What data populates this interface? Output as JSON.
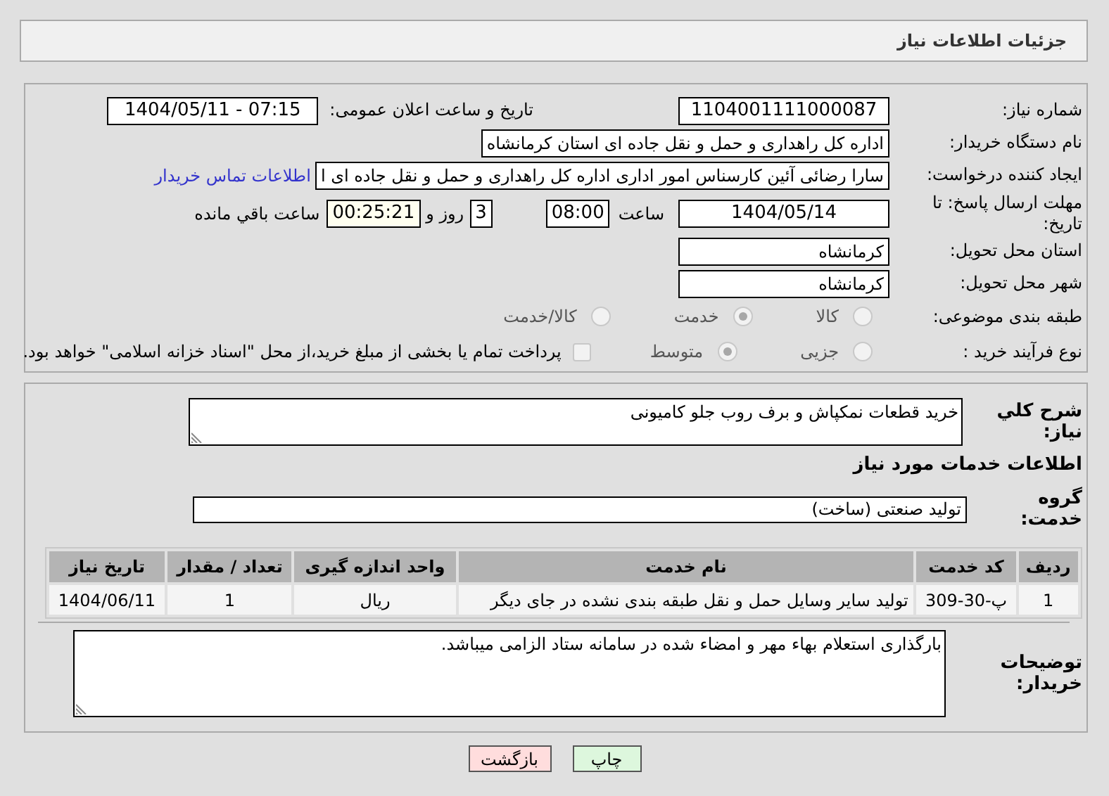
{
  "header": {
    "title": "جزئیات اطلاعات نیاز"
  },
  "details": {
    "need_number": {
      "label": "شماره نیاز:",
      "value": "1104001111000087"
    },
    "announce": {
      "label": "تاریخ و ساعت اعلان عمومی:",
      "value": "1404/05/11 - 07:15"
    },
    "buyer": {
      "label": "نام دستگاه خریدار:",
      "value": "اداره کل راهداری و حمل و نقل جاده ای استان کرمانشاه"
    },
    "creator": {
      "label": "ایجاد کننده درخواست:",
      "value": "سارا رضائی آئین کارسناس امور اداری اداره کل راهداری و حمل و نقل جاده ای ا",
      "link": "اطلاعات تماس خریدار"
    },
    "deadline": {
      "label": "مهلت ارسال پاسخ: تا تاریخ:",
      "date": "1404/05/14",
      "time_label": "ساعت",
      "time": "08:00",
      "days": "3",
      "days_label": "روز و",
      "remaining": "00:25:21",
      "remaining_label": "ساعت باقي مانده"
    },
    "province": {
      "label": "استان محل تحویل:",
      "value": "کرمانشاه"
    },
    "city": {
      "label": "شهر محل تحویل:",
      "value": "کرمانشاه"
    },
    "category": {
      "label": "طبقه بندی موضوعی:",
      "options": [
        {
          "label": "کالا",
          "selected": false
        },
        {
          "label": "خدمت",
          "selected": true
        },
        {
          "label": "کالا/خدمت",
          "selected": false
        }
      ]
    },
    "process": {
      "label": "نوع فرآیند خرید :",
      "options": [
        {
          "label": "جزیی",
          "selected": false
        },
        {
          "label": "متوسط",
          "selected": true
        }
      ],
      "payment": {
        "checked": false,
        "text": "پرداخت تمام یا بخشی از مبلغ خرید،از محل \"اسناد خزانه اسلامی\" خواهد بود."
      }
    }
  },
  "need": {
    "summary_label": "شرح کلي نياز:",
    "summary": "خرید قطعات نمکپاش و برف روب جلو کامیونی",
    "services_heading": "اطلاعات خدمات مورد نياز",
    "group_label": "گروه خدمت:",
    "group": "تولید صنعتی (ساخت)",
    "table": {
      "columns": [
        "ردیف",
        "کد خدمت",
        "نام خدمت",
        "واحد اندازه گیری",
        "تعداد / مقدار",
        "تاریخ نیاز"
      ],
      "rows": [
        [
          "1",
          "پ-30-309",
          "تولید سایر وسایل حمل و نقل طبقه بندی نشده در جای دیگر",
          "ریال",
          "1",
          "1404/06/11"
        ]
      ]
    },
    "notes_label": "توضیحات خریدار:",
    "notes": "بارگذاری استعلام بهاء مهر و امضاء شده در سامانه ستاد الزامی میباشد."
  },
  "buttons": [
    {
      "kind": "print",
      "label": "چاپ"
    },
    {
      "kind": "back",
      "label": "بازگشت"
    }
  ]
}
